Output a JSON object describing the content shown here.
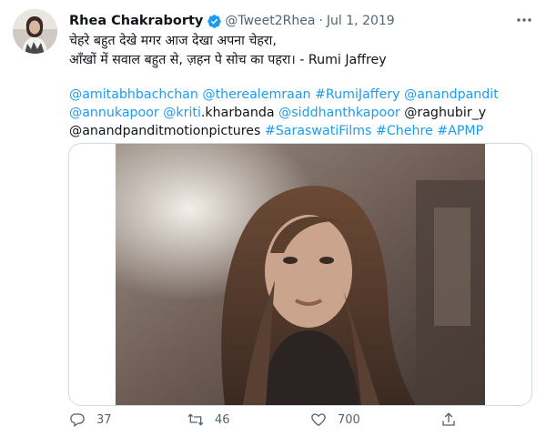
{
  "tweet": {
    "author_name": "Rhea Chakraborty",
    "handle": "@Tweet2Rhea",
    "separator": "·",
    "date": "Jul 1, 2019",
    "text_lines": [
      "चेहरे बहुत देखे मगर आज देखा अपना चेहरा,",
      "आँखों में सवाल बहुत से, ज़हन पे सोच का पहरा। - Rumi Jaffrey"
    ],
    "tags_line1": [
      "@amitabhbachchan",
      "@therealemraan",
      "#RumiJaffery",
      "@anandpandit"
    ],
    "tags_line2": {
      "t1": "@annukapoor",
      "t2": "@kriti",
      "t2_plain": ".kharbanda",
      "t3": "@siddhanthkapoor",
      "t4": "@raghubir_y"
    },
    "tags_line3": [
      "@anandpanditmotionpictures",
      "#SaraswatiFilms",
      "#Chehre",
      "#APMP"
    ]
  },
  "actions": {
    "reply_count": "37",
    "retweet_count": "46",
    "like_count": "700"
  },
  "colors": {
    "link": "#1d9bf0",
    "muted": "#536471",
    "verified": "#1d9bf0",
    "border": "#cfd9de"
  },
  "icons": [
    "verified-badge-icon",
    "more-options-icon",
    "reply-icon",
    "retweet-icon",
    "like-icon",
    "share-icon"
  ]
}
